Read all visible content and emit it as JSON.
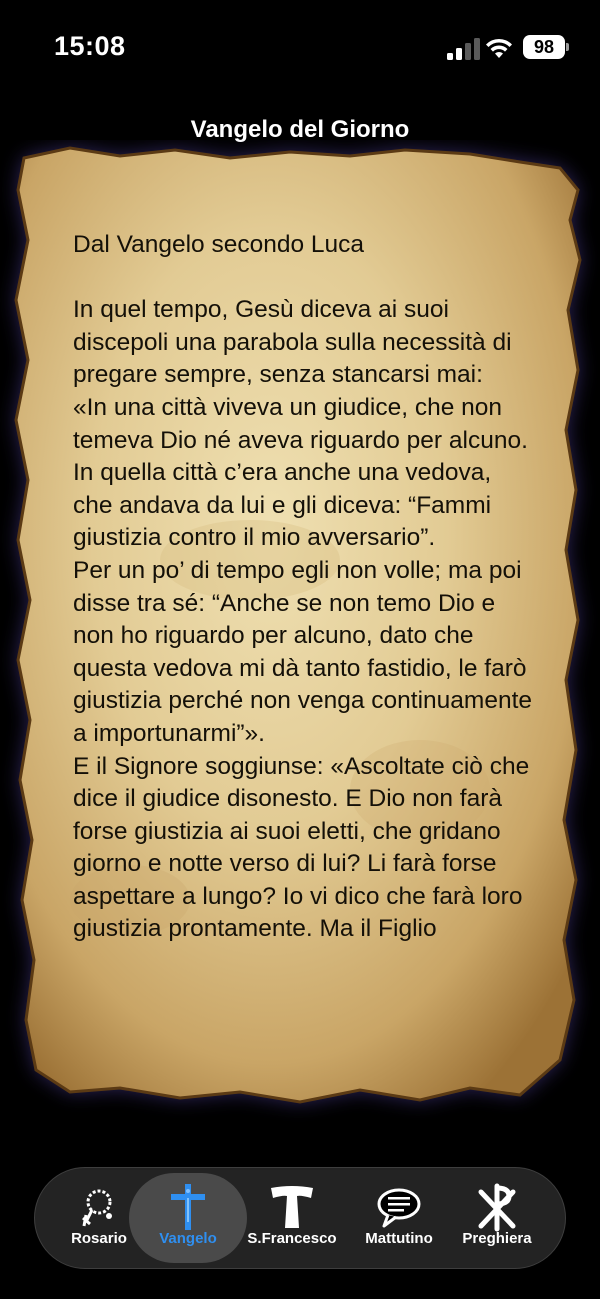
{
  "status": {
    "time": "15:08",
    "battery": "98"
  },
  "header": {
    "title": "Vangelo del Giorno"
  },
  "reading": {
    "text": "Dal Vangelo secondo Luca\n\nIn quel tempo, Gesù diceva ai suoi discepoli una parabola sulla necessità di pregare sempre, senza stancarsi mai:\n«In una città viveva un giudice, che non temeva Dio né aveva riguardo per alcuno. In quella città c’era anche una vedova, che andava da lui e gli diceva: “Fammi giustizia contro il mio avversario”.\nPer un po’ di tempo egli non volle; ma poi disse tra sé: “Anche se non temo Dio e non ho riguardo per alcuno, dato che questa vedova mi dà tanto fastidio, le farò giustizia perché non venga continuamente a importunarmi”».\nE il Signore soggiunse: «Ascoltate ciò che dice il giudice disonesto. E Dio non farà forse giustizia ai suoi eletti, che gridano giorno e notte verso di lui? Li farà forse aspettare a lungo? Io vi dico che farà loro giustizia prontamente. Ma il Figlio"
  },
  "tabs": [
    {
      "label": "Rosario",
      "icon": "rosary-icon"
    },
    {
      "label": "Vangelo",
      "icon": "crucifix-icon",
      "active": true
    },
    {
      "label": "S.Francesco",
      "icon": "tau-cross-icon"
    },
    {
      "label": "Mattutino",
      "icon": "speech-bubble-icon"
    },
    {
      "label": "Preghiera",
      "icon": "chi-rho-icon"
    }
  ],
  "colors": {
    "accent": "#2f8ff0",
    "parchment": "#e2cb94",
    "text": "#141008",
    "tabbar": "#262626"
  }
}
